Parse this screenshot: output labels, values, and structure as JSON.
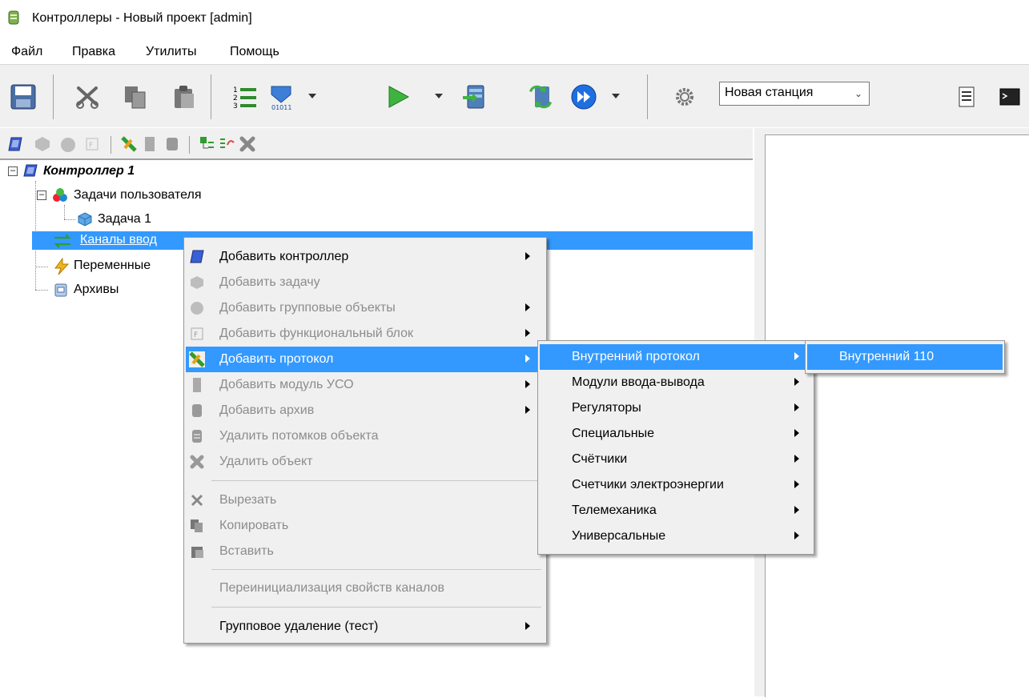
{
  "window": {
    "title": "Контроллеры - Новый проект [admin]"
  },
  "menubar": [
    "Файл",
    "Правка",
    "Утилиты",
    "Помощь"
  ],
  "toolbar": {
    "station_value": "Новая станция"
  },
  "tree": {
    "root": "Контроллер 1",
    "user_tasks": "Задачи пользователя",
    "task1": "Задача 1",
    "channels": "Каналы ввод",
    "variables": "Переменные",
    "archives": "Архивы"
  },
  "context_menu": {
    "items": [
      "Добавить контроллер",
      "Добавить задачу",
      "Добавить групповые объекты",
      "Добавить функциональный блок",
      "Добавить протокол",
      "Добавить модуль УСО",
      "Добавить архив",
      "Удалить потомков объекта",
      "Удалить объект",
      "Вырезать",
      "Копировать",
      "Вставить",
      "Переинициализация свойств каналов",
      "Групповое удаление (тест)"
    ]
  },
  "protocol_submenu": {
    "items": [
      "Внутренний протокол",
      "Модули ввода-вывода",
      "Регуляторы",
      "Специальные",
      "Счётчики",
      "Счетчики электроэнергии",
      "Телемеханика",
      "Универсальные"
    ]
  },
  "internal_submenu": {
    "items": [
      "Внутренний 110"
    ]
  },
  "colors": {
    "selection": "#3399ff",
    "menu_bg": "#f0f0f0",
    "disabled_text": "#8c8c8c"
  }
}
